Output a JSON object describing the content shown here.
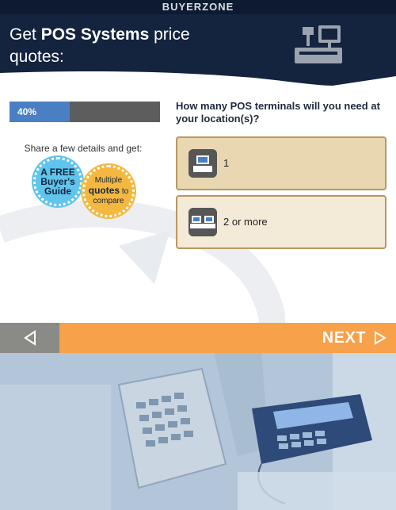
{
  "header": {
    "brand": "BUYERZONE",
    "headline_prefix": "Get ",
    "headline_bold": "POS Systems",
    "headline_suffix": " price quotes:"
  },
  "progress": {
    "label": "40%",
    "value": 0.4,
    "fill_color": "#4a7fc4"
  },
  "intro": {
    "share_text": "Share a few details and get:"
  },
  "badges": {
    "guide_line1": "A FREE",
    "guide_line2": "Buyer's",
    "guide_line3": "Guide",
    "quotes_line1": "Multiple",
    "quotes_bold": "quotes",
    "quotes_to": " to",
    "quotes_line3": "compare"
  },
  "question": {
    "text": "How many POS terminals will you need at your location(s)?",
    "options": [
      {
        "label": "1",
        "icon": "single-terminal-icon"
      },
      {
        "label": "2 or more",
        "icon": "multiple-terminals-icon"
      }
    ]
  },
  "nav": {
    "back_icon": "chevron-left-icon",
    "next_label": "NEXT",
    "next_icon": "chevron-right-icon"
  },
  "colors": {
    "header_bg": "#14233e",
    "accent_orange": "#f7a14a",
    "option_border": "#b99860"
  }
}
